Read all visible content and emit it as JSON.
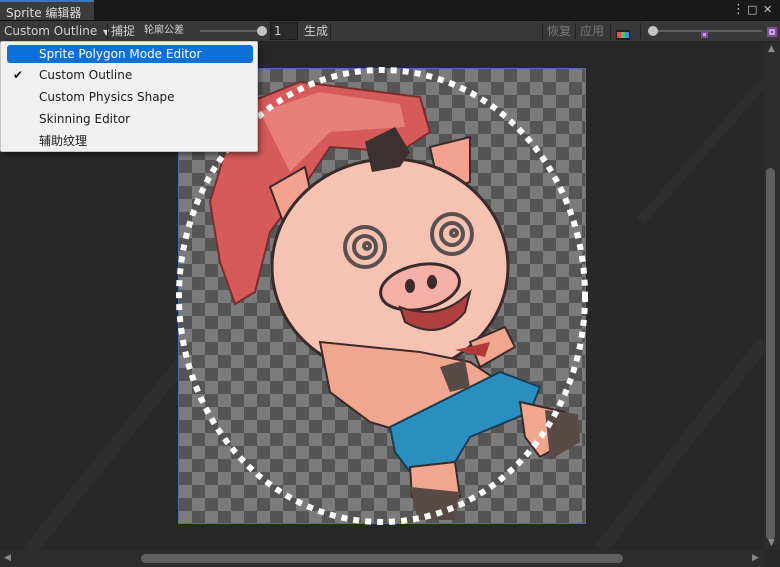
{
  "window": {
    "tab_title": "Sprite 编辑器",
    "menu_icon": "⋮",
    "maximize_icon": "□",
    "close_icon": "✕"
  },
  "toolbar": {
    "mode_dropdown": "Custom Outline",
    "snap_label": "捕捉",
    "tolerance_label": "轮廓公差",
    "tolerance_value": "1",
    "tolerance_slider_fraction": 1.0,
    "generate_label": "生成",
    "revert_label": "恢复",
    "apply_label": "应用",
    "zoom_slider_fraction": 0.0
  },
  "mode_menu": {
    "items": [
      {
        "label": "Sprite Polygon Mode Editor",
        "highlighted": true,
        "checked": false
      },
      {
        "label": "Custom Outline",
        "highlighted": false,
        "checked": true
      },
      {
        "label": "Custom Physics Shape",
        "highlighted": false,
        "checked": false
      },
      {
        "label": "Skinning Editor",
        "highlighted": false,
        "checked": false
      },
      {
        "label": "辅助纹理",
        "highlighted": false,
        "checked": false
      }
    ],
    "check_glyph": "✔"
  },
  "canvas": {
    "sprite_name": "pig character sprite",
    "outline_color": "#ffffff"
  },
  "colors": {
    "accent": "#0d6fd8",
    "frame_border": "#4a6fb4",
    "tab_accent": "#3a79bb"
  }
}
